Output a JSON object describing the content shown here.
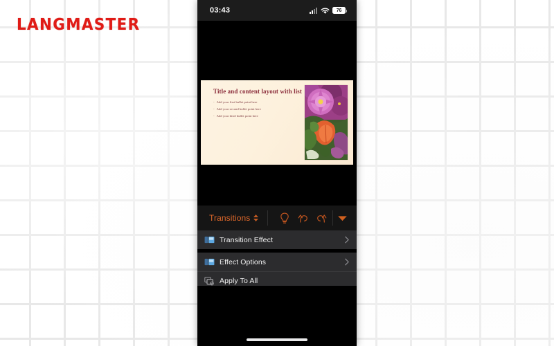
{
  "watermark": {
    "text": "LANGMASTER",
    "color": "#e01b16"
  },
  "phone": {
    "status_bar": {
      "time": "03:43",
      "signal_icon": "cellular-signal-icon",
      "wifi_icon": "wifi-icon",
      "battery_icon": "battery-icon",
      "battery_level": "76"
    },
    "slide": {
      "title": "Title and content layout with list",
      "bullet_marker": "-",
      "bullets": [
        "Add your first bullet point here",
        "Add your second bullet point here",
        "Add your third bullet point here"
      ],
      "photo_alt": "flower-photo",
      "background_color": "#fdf3e2",
      "title_color": "#8c2f3d"
    },
    "toolbar": {
      "tab_label": "Transitions",
      "tab_color": "#e1692b",
      "stepper_icon": "chevron-up-down-icon",
      "buttons": [
        {
          "name": "lightbulb-icon",
          "label": "Ideas"
        },
        {
          "name": "undo-icon",
          "label": "Undo"
        },
        {
          "name": "redo-icon",
          "label": "Redo"
        }
      ],
      "caret_icon": "caret-down-icon"
    },
    "menu": {
      "groups": [
        {
          "rows": [
            {
              "icon": "slide-transition-icon",
              "label": "Transition Effect",
              "chevron": true
            }
          ]
        },
        {
          "rows": [
            {
              "icon": "slide-transition-icon",
              "label": "Effect Options",
              "chevron": true
            },
            {
              "icon": "apply-to-all-icon",
              "label": "Apply To All",
              "chevron": false
            }
          ]
        }
      ]
    },
    "home_indicator": "home-indicator"
  }
}
